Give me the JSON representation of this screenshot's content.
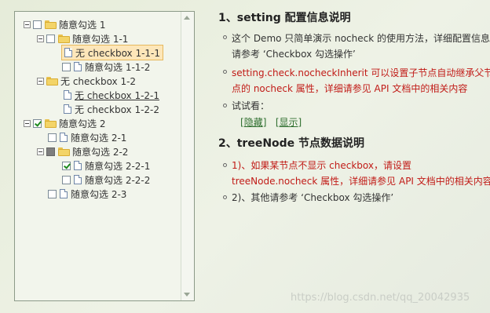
{
  "tree": {
    "nodes": [
      {
        "label": "随意勾选 1",
        "check": "none",
        "icon": "folder"
      },
      {
        "label": "随意勾选 1-1",
        "check": "none",
        "icon": "folder"
      },
      {
        "label": "无 checkbox 1-1-1",
        "check": "hidden",
        "icon": "doc",
        "selected": true
      },
      {
        "label": "随意勾选 1-1-2",
        "check": "none",
        "icon": "doc"
      },
      {
        "label": "无 checkbox 1-2",
        "check": "hidden",
        "icon": "folder"
      },
      {
        "label": "无 checkbox 1-2-1",
        "check": "hidden",
        "icon": "doc"
      },
      {
        "label": "无 checkbox 1-2-2",
        "check": "hidden",
        "icon": "doc"
      },
      {
        "label": "随意勾选 2",
        "check": "checked",
        "icon": "folder"
      },
      {
        "label": "随意勾选 2-1",
        "check": "none",
        "icon": "doc"
      },
      {
        "label": "随意勾选 2-2",
        "check": "partial",
        "icon": "folder"
      },
      {
        "label": "随意勾选 2-2-1",
        "check": "checked",
        "icon": "doc"
      },
      {
        "label": "随意勾选 2-2-2",
        "check": "none",
        "icon": "doc"
      },
      {
        "label": "随意勾选 2-3",
        "check": "none",
        "icon": "doc"
      }
    ]
  },
  "section1": {
    "title": "1、setting 配置信息说明",
    "item1": {
      "line1": "这个 Demo 只简单演示 nocheck 的使用方法，详细配置信息",
      "line2": "请参考 ‘Checkbox 勾选操作’"
    },
    "item2": {
      "line1": "setting.check.nocheckInherit 可以设置子节点自动继承父节",
      "line2": "点的 nocheck 属性，详细请参见 API 文档中的相关内容"
    },
    "item3": {
      "label": "试试看：",
      "hide_link": "隐藏",
      "show_link": "显示",
      "bracket_open": "[",
      "bracket_close": "]"
    }
  },
  "section2": {
    "title": "2、treeNode 节点数据说明",
    "item1": {
      "line1": "1)、如果某节点不显示 checkbox，请设置",
      "line2": "treeNode.nocheck 属性，详细请参见 API 文档中的相关内容"
    },
    "item2": {
      "line1": "2)、其他请参考 ‘Checkbox 勾选操作’"
    }
  },
  "watermark": "https://blog.csdn.net/qq_20042935",
  "colors": {
    "accent_red": "#c11b17",
    "link_green": "#2f6f2f",
    "selected_bg": "#fde6b9"
  }
}
